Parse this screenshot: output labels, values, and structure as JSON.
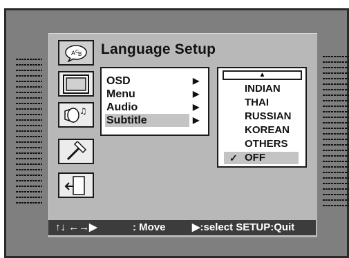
{
  "menu_title": "Language Setup",
  "left_icons": [
    {
      "name": "language-icon",
      "selected": true
    },
    {
      "name": "tv-icon"
    },
    {
      "name": "speaker-audio-icon"
    },
    {
      "name": "hammer-tools-icon"
    },
    {
      "name": "exit-door-icon"
    }
  ],
  "main_menu": {
    "items": [
      {
        "label": "OSD"
      },
      {
        "label": "Menu"
      },
      {
        "label": "Audio"
      },
      {
        "label": "Subtitle",
        "highlighted": true
      }
    ],
    "arrow_glyph": "▶"
  },
  "submenu": {
    "scroll_up_glyph": "▲",
    "options": [
      {
        "label": "INDIAN"
      },
      {
        "label": "THAI"
      },
      {
        "label": "RUSSIAN"
      },
      {
        "label": "KOREAN"
      },
      {
        "label": "OTHERS"
      },
      {
        "label": "OFF",
        "checked": true,
        "highlighted": true
      }
    ],
    "check_glyph": "✓"
  },
  "footer": {
    "move_glyphs": "↑↓ ←→▶",
    "move_label": ": Move",
    "select_label": "▶:select SETUP:Quit"
  },
  "colors": {
    "screen_bg": "#7f7f7f",
    "panel_bg": "#b8b8b8",
    "footer_bg": "#3c3c3c",
    "highlight": "#c4c4c4"
  }
}
